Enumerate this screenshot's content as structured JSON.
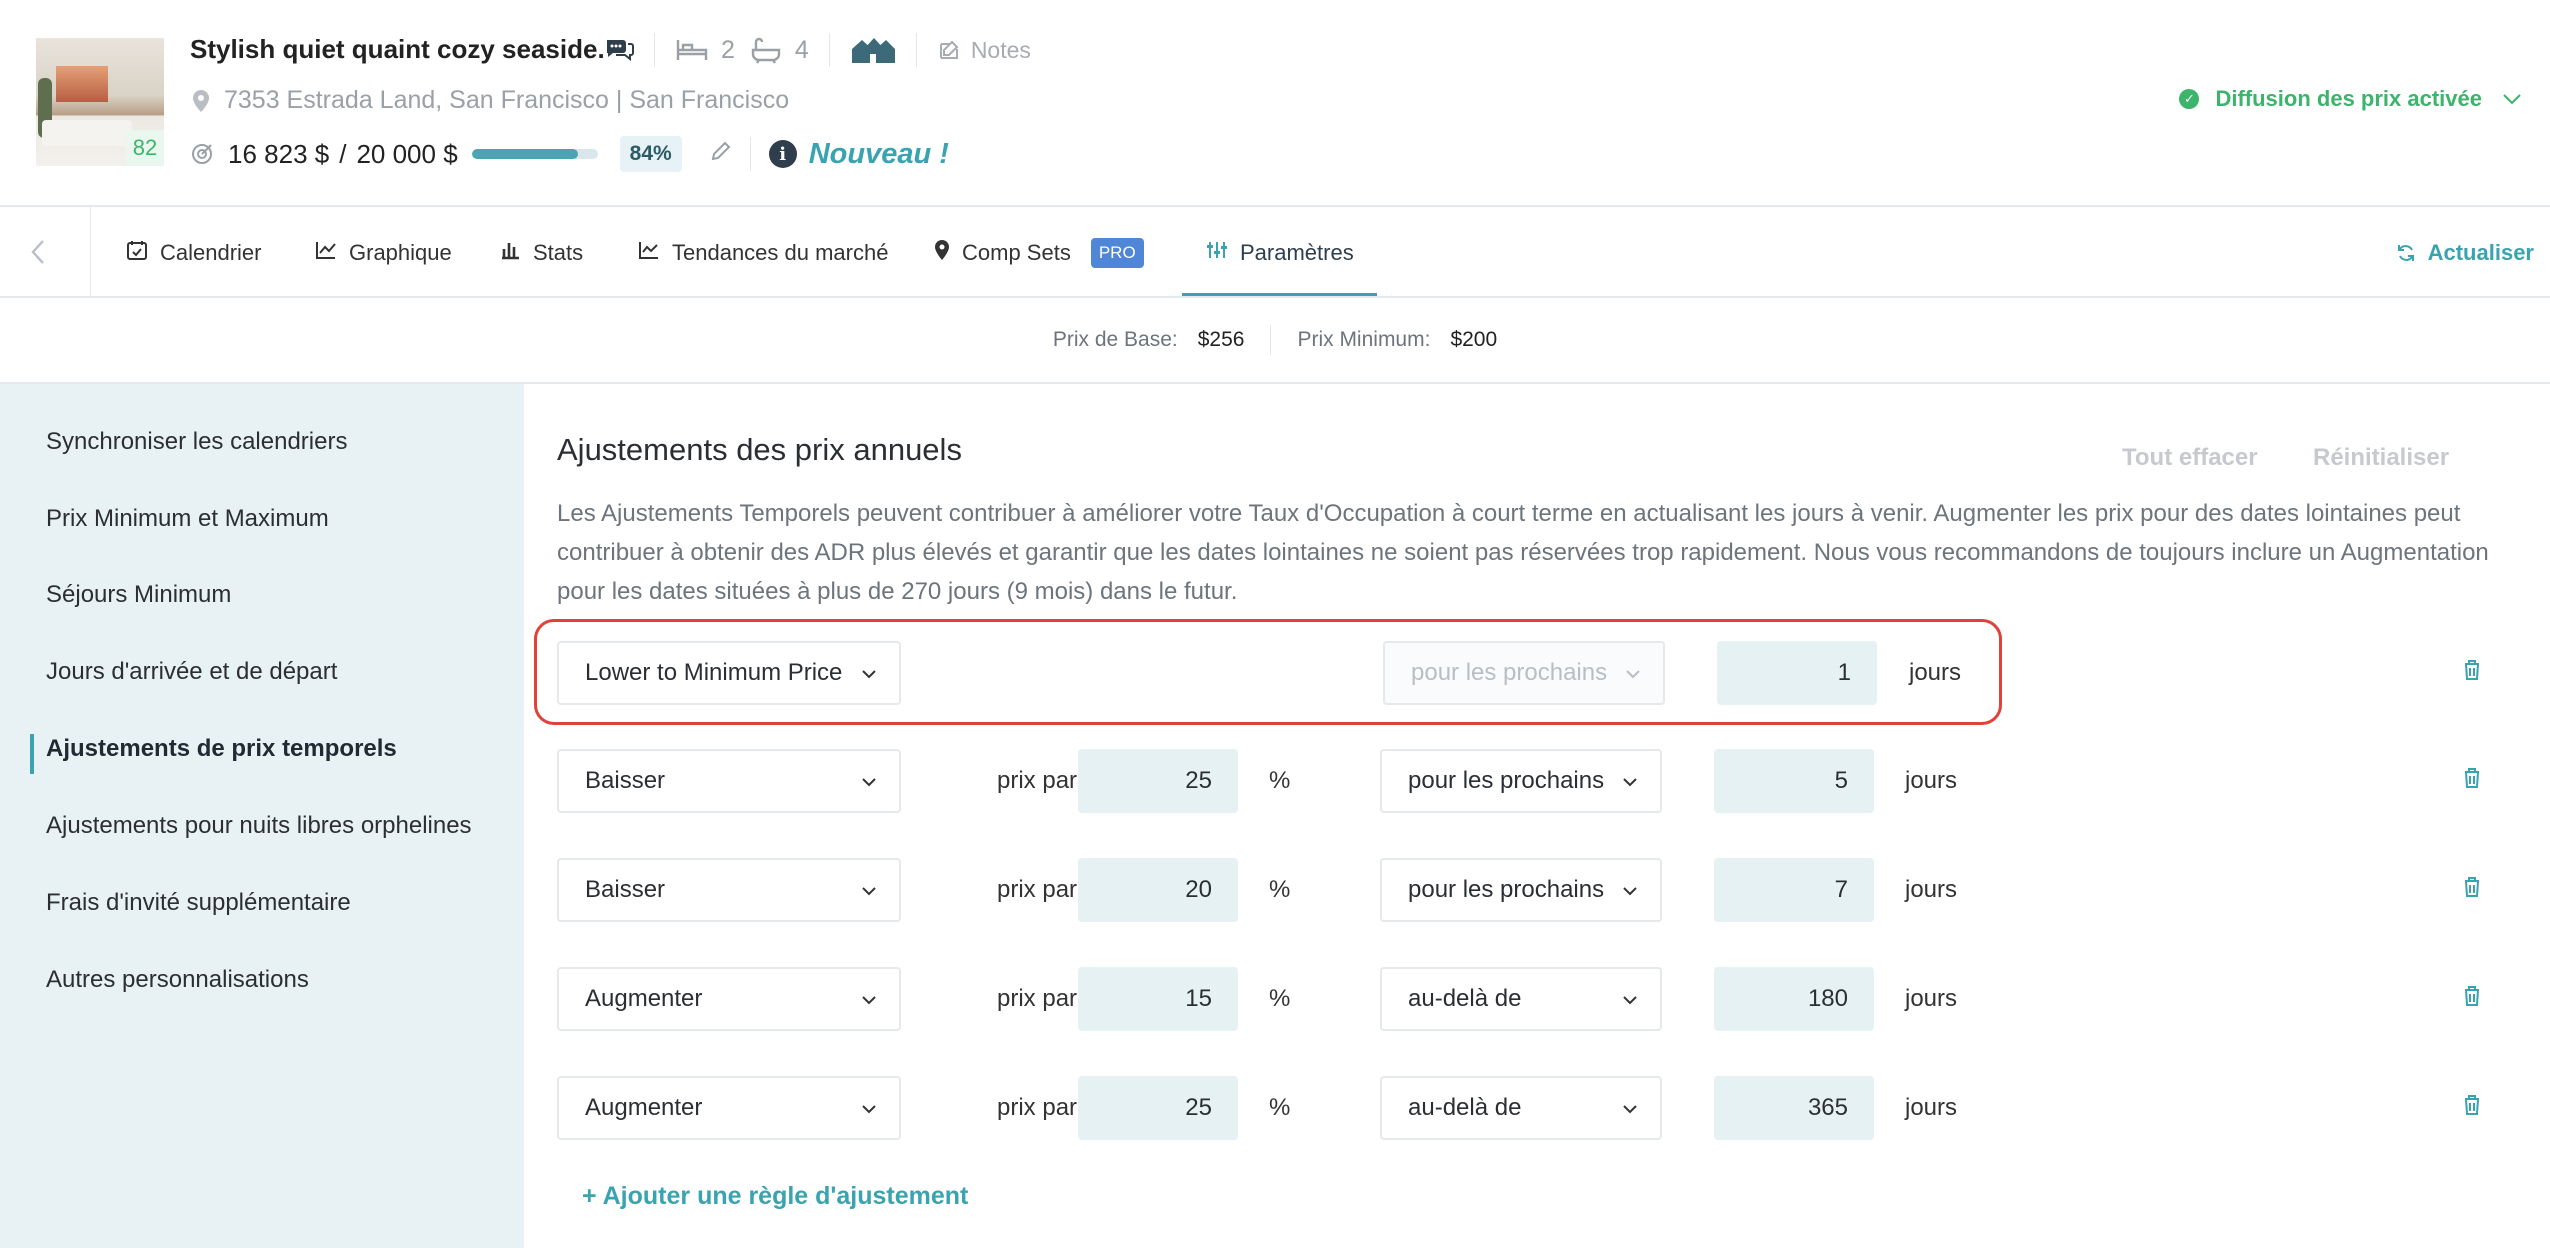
{
  "listing": {
    "score": "82",
    "title": "Stylish quiet quaint cozy seaside.",
    "bedrooms": "2",
    "bathrooms": "4",
    "notes_label": "Notes",
    "address": "7353 Estrada Land, San Francisco | San Francisco",
    "revenue_current": "16 823 $",
    "revenue_separator": "/",
    "revenue_target": "20 000 $",
    "progress_percent": 84,
    "progress_label": "84%",
    "new_label": "Nouveau !",
    "diffusion_label": "Diffusion des prix activée"
  },
  "tabs": [
    {
      "label": "Calendrier",
      "icon": "calendar-check-icon"
    },
    {
      "label": "Graphique",
      "icon": "line-chart-icon"
    },
    {
      "label": "Stats",
      "icon": "bar-chart-icon"
    },
    {
      "label": "Tendances du marché",
      "icon": "trend-icon"
    },
    {
      "label": "Comp Sets",
      "icon": "map-pin-icon",
      "badge": "PRO"
    },
    {
      "label": "Paramètres",
      "icon": "sliders-icon",
      "active": true
    }
  ],
  "refresh_label": "Actualiser",
  "prices": {
    "base_label": "Prix de Base:",
    "base_value": "$256",
    "min_label": "Prix Minimum:",
    "min_value": "$200"
  },
  "sidebar": {
    "items": [
      {
        "label": "Synchroniser les calendriers"
      },
      {
        "label": "Prix Minimum et Maximum"
      },
      {
        "label": "Séjours Minimum"
      },
      {
        "label": "Jours d'arrivée et de départ"
      },
      {
        "label": "Ajustements de prix temporels",
        "active": true
      },
      {
        "label": "Ajustements pour nuits libres orphelines"
      },
      {
        "label": "Frais d'invité supplémentaire"
      },
      {
        "label": "Autres personnalisations"
      }
    ]
  },
  "main": {
    "title": "Ajustements des prix annuels",
    "clear_all": "Tout effacer",
    "reset": "Réinitialiser",
    "description": "Les Ajustements Temporels peuvent contribuer à améliorer votre Taux d'Occupation à court terme en actualisant les jours à venir. Augmenter les prix pour des dates lointaines peut contribuer à obtenir des ADR plus élevés et garantir que les dates lointaines ne soient pas réservées trop rapidement. Nous vous recommandons de toujours inclure un Augmentation pour les dates situées à plus de 270 jours (9 mois) dans le futur.",
    "price_per_label": "prix par",
    "percent_sign": "%",
    "days_label": "jours",
    "rules": [
      {
        "action": "Lower to Minimum Price",
        "period": "pour les prochains",
        "days": "1"
      },
      {
        "action": "Baisser",
        "value": "25",
        "period": "pour les prochains",
        "days": "5"
      },
      {
        "action": "Baisser",
        "value": "20",
        "period": "pour les prochains",
        "days": "7"
      },
      {
        "action": "Augmenter",
        "value": "15",
        "period": "au-delà de",
        "days": "180"
      },
      {
        "action": "Augmenter",
        "value": "25",
        "period": "au-delà de",
        "days": "365"
      }
    ],
    "add_rule": "+ Ajouter une règle d'ajustement"
  },
  "colors": {
    "accent": "#3aa3b0",
    "success": "#3cb46c",
    "highlight": "#e0423a",
    "sidebar_bg": "#e8f1f3",
    "input_bg": "#e6f1f4",
    "pro_badge": "#4f86d8"
  }
}
